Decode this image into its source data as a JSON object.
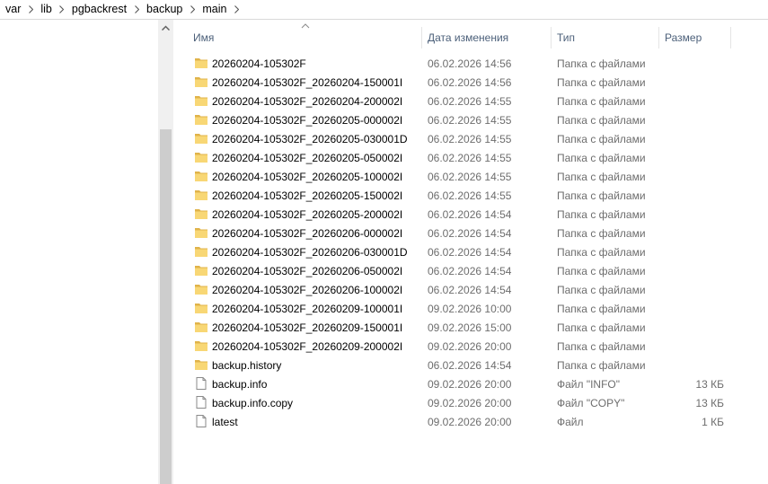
{
  "breadcrumb": {
    "items": [
      "var",
      "lib",
      "pgbackrest",
      "backup",
      "main"
    ],
    "separator_icon": "chevron-right-icon"
  },
  "columns": {
    "name": "Имя",
    "date": "Дата изменения",
    "type": "Тип",
    "size": "Размер",
    "sort_icon": "sort-ascending-icon"
  },
  "files": [
    {
      "name": "20260204-105302F",
      "date": "06.02.2026 14:56",
      "type": "Папка с файлами",
      "size": "",
      "icon": "folder-icon"
    },
    {
      "name": "20260204-105302F_20260204-150001I",
      "date": "06.02.2026 14:56",
      "type": "Папка с файлами",
      "size": "",
      "icon": "folder-icon"
    },
    {
      "name": "20260204-105302F_20260204-200002I",
      "date": "06.02.2026 14:55",
      "type": "Папка с файлами",
      "size": "",
      "icon": "folder-icon"
    },
    {
      "name": "20260204-105302F_20260205-000002I",
      "date": "06.02.2026 14:55",
      "type": "Папка с файлами",
      "size": "",
      "icon": "folder-icon"
    },
    {
      "name": "20260204-105302F_20260205-030001D",
      "date": "06.02.2026 14:55",
      "type": "Папка с файлами",
      "size": "",
      "icon": "folder-icon"
    },
    {
      "name": "20260204-105302F_20260205-050002I",
      "date": "06.02.2026 14:55",
      "type": "Папка с файлами",
      "size": "",
      "icon": "folder-icon"
    },
    {
      "name": "20260204-105302F_20260205-100002I",
      "date": "06.02.2026 14:55",
      "type": "Папка с файлами",
      "size": "",
      "icon": "folder-icon"
    },
    {
      "name": "20260204-105302F_20260205-150002I",
      "date": "06.02.2026 14:55",
      "type": "Папка с файлами",
      "size": "",
      "icon": "folder-icon"
    },
    {
      "name": "20260204-105302F_20260205-200002I",
      "date": "06.02.2026 14:54",
      "type": "Папка с файлами",
      "size": "",
      "icon": "folder-icon"
    },
    {
      "name": "20260204-105302F_20260206-000002I",
      "date": "06.02.2026 14:54",
      "type": "Папка с файлами",
      "size": "",
      "icon": "folder-icon"
    },
    {
      "name": "20260204-105302F_20260206-030001D",
      "date": "06.02.2026 14:54",
      "type": "Папка с файлами",
      "size": "",
      "icon": "folder-icon"
    },
    {
      "name": "20260204-105302F_20260206-050002I",
      "date": "06.02.2026 14:54",
      "type": "Папка с файлами",
      "size": "",
      "icon": "folder-icon"
    },
    {
      "name": "20260204-105302F_20260206-100002I",
      "date": "06.02.2026 14:54",
      "type": "Папка с файлами",
      "size": "",
      "icon": "folder-icon"
    },
    {
      "name": "20260204-105302F_20260209-100001I",
      "date": "09.02.2026 10:00",
      "type": "Папка с файлами",
      "size": "",
      "icon": "folder-icon"
    },
    {
      "name": "20260204-105302F_20260209-150001I",
      "date": "09.02.2026 15:00",
      "type": "Папка с файлами",
      "size": "",
      "icon": "folder-icon"
    },
    {
      "name": "20260204-105302F_20260209-200002I",
      "date": "09.02.2026 20:00",
      "type": "Папка с файлами",
      "size": "",
      "icon": "folder-icon"
    },
    {
      "name": "backup.history",
      "date": "06.02.2026 14:54",
      "type": "Папка с файлами",
      "size": "",
      "icon": "folder-icon"
    },
    {
      "name": "backup.info",
      "date": "09.02.2026 20:00",
      "type": "Файл \"INFO\"",
      "size": "13 КБ",
      "icon": "file-icon"
    },
    {
      "name": "backup.info.copy",
      "date": "09.02.2026 20:00",
      "type": "Файл \"COPY\"",
      "size": "13 КБ",
      "icon": "file-icon"
    },
    {
      "name": "latest",
      "date": "09.02.2026 20:00",
      "type": "Файл",
      "size": "1 КБ",
      "icon": "file-icon"
    }
  ],
  "colors": {
    "folder": "#f8d775",
    "folder_dark": "#e0b34a",
    "header_text": "#4c607a",
    "meta_text": "#6d6d6d",
    "scrollbar_track": "#f0f0f0",
    "scrollbar_thumb": "#cdcdcd"
  }
}
